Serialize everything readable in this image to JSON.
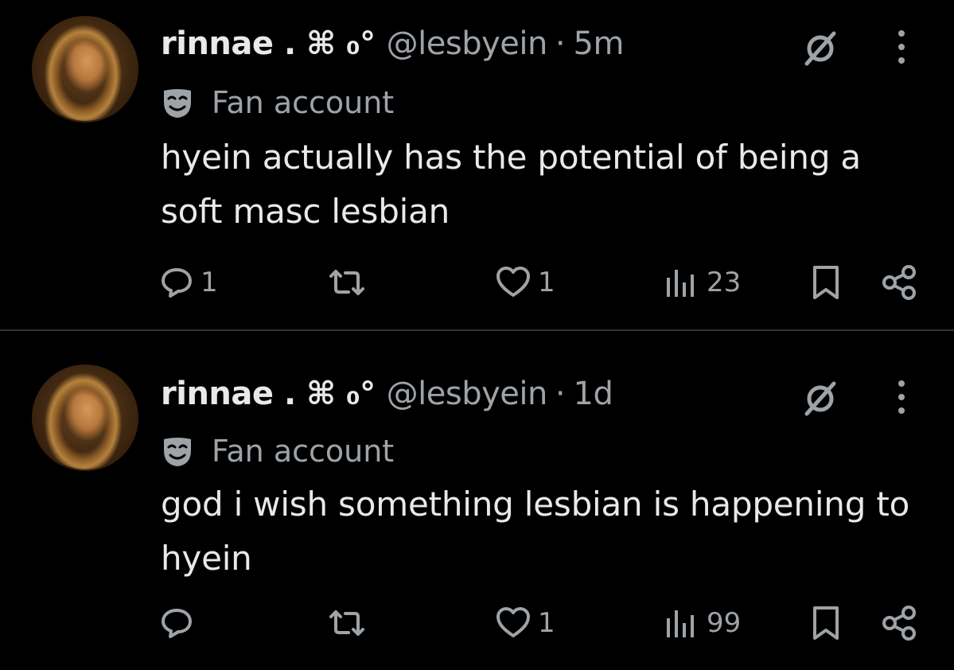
{
  "tweets": [
    {
      "display_name": "rinnae . ⌘ ₀°",
      "handle": "@lesbyein",
      "separator": "·",
      "time": "5m",
      "label": "Fan account",
      "text": "hyein actually has the potential of being a soft masc lesbian",
      "reply_count": "1",
      "retweet_count": "",
      "like_count": "1",
      "view_count": "23"
    },
    {
      "display_name": "rinnae . ⌘ ₀°",
      "handle": "@lesbyein",
      "separator": "·",
      "time": "1d",
      "label": "Fan account",
      "text": "god i wish something lesbian is happening to hyein",
      "reply_count": "",
      "retweet_count": "",
      "like_count": "1",
      "view_count": "99"
    }
  ],
  "icons": {
    "reply": "speech-bubble-icon",
    "retweet": "retweet-icon",
    "like": "heart-icon",
    "views": "bar-chart-icon",
    "bookmark": "bookmark-icon",
    "share": "share-icon",
    "mute": "mute-icon",
    "more": "more-dots-icon",
    "label": "mask-icon"
  },
  "colors": {
    "background": "#000000",
    "primary_text": "#e7e9ea",
    "secondary_text": "#9ea3a8",
    "divider": "#2f3336"
  }
}
